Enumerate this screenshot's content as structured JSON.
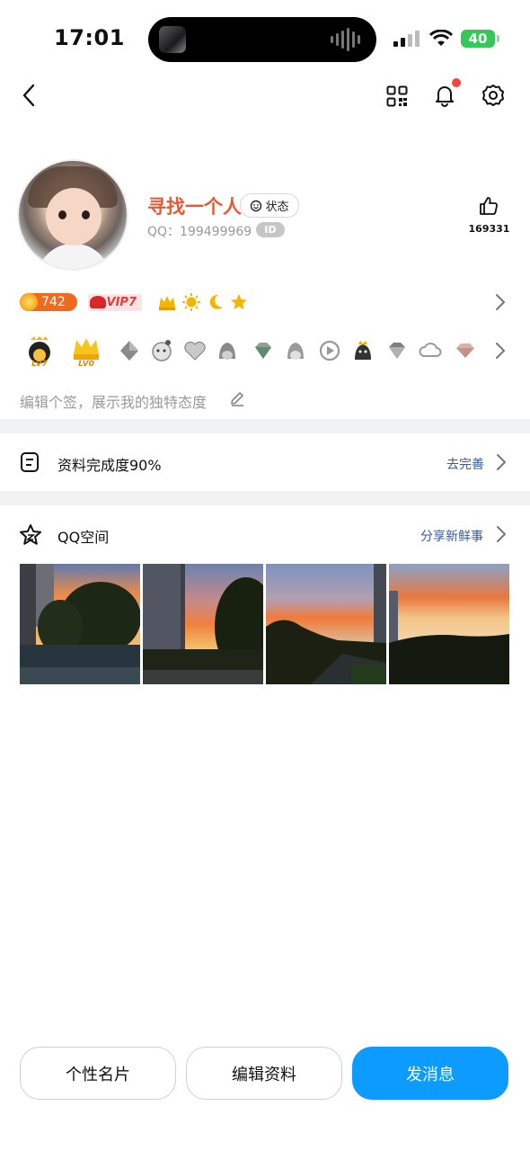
{
  "status_bar": {
    "time": "17:01",
    "battery": "40"
  },
  "profile": {
    "nickname": "寻找一个人",
    "status_label": "状态",
    "qq_label": "QQ：",
    "qq_number": "199499969",
    "id_badge": "ID",
    "likes": "169331",
    "coin_value": "742",
    "vip_label": "VIP7",
    "level_tags": [
      "LV7",
      "LV0"
    ],
    "signature_placeholder": "编辑个签，展示我的独特态度"
  },
  "completion": {
    "label": "资料完成度90%",
    "action": "去完善"
  },
  "qzone": {
    "label": "QQ空间",
    "action": "分享新鲜事"
  },
  "buttons": {
    "card": "个性名片",
    "edit": "编辑资料",
    "message": "发消息"
  },
  "colors": {
    "accent": "#0d9bff",
    "nickname": "#e45a33",
    "link": "#3a5a9a",
    "separator": "#f1f2f4"
  },
  "icons": [
    "back-icon",
    "qr-code-icon",
    "bell-icon",
    "gear-icon",
    "thumbs-up-icon",
    "edit-pen-icon",
    "document-icon",
    "star-icon",
    "chevron-right-icon"
  ]
}
